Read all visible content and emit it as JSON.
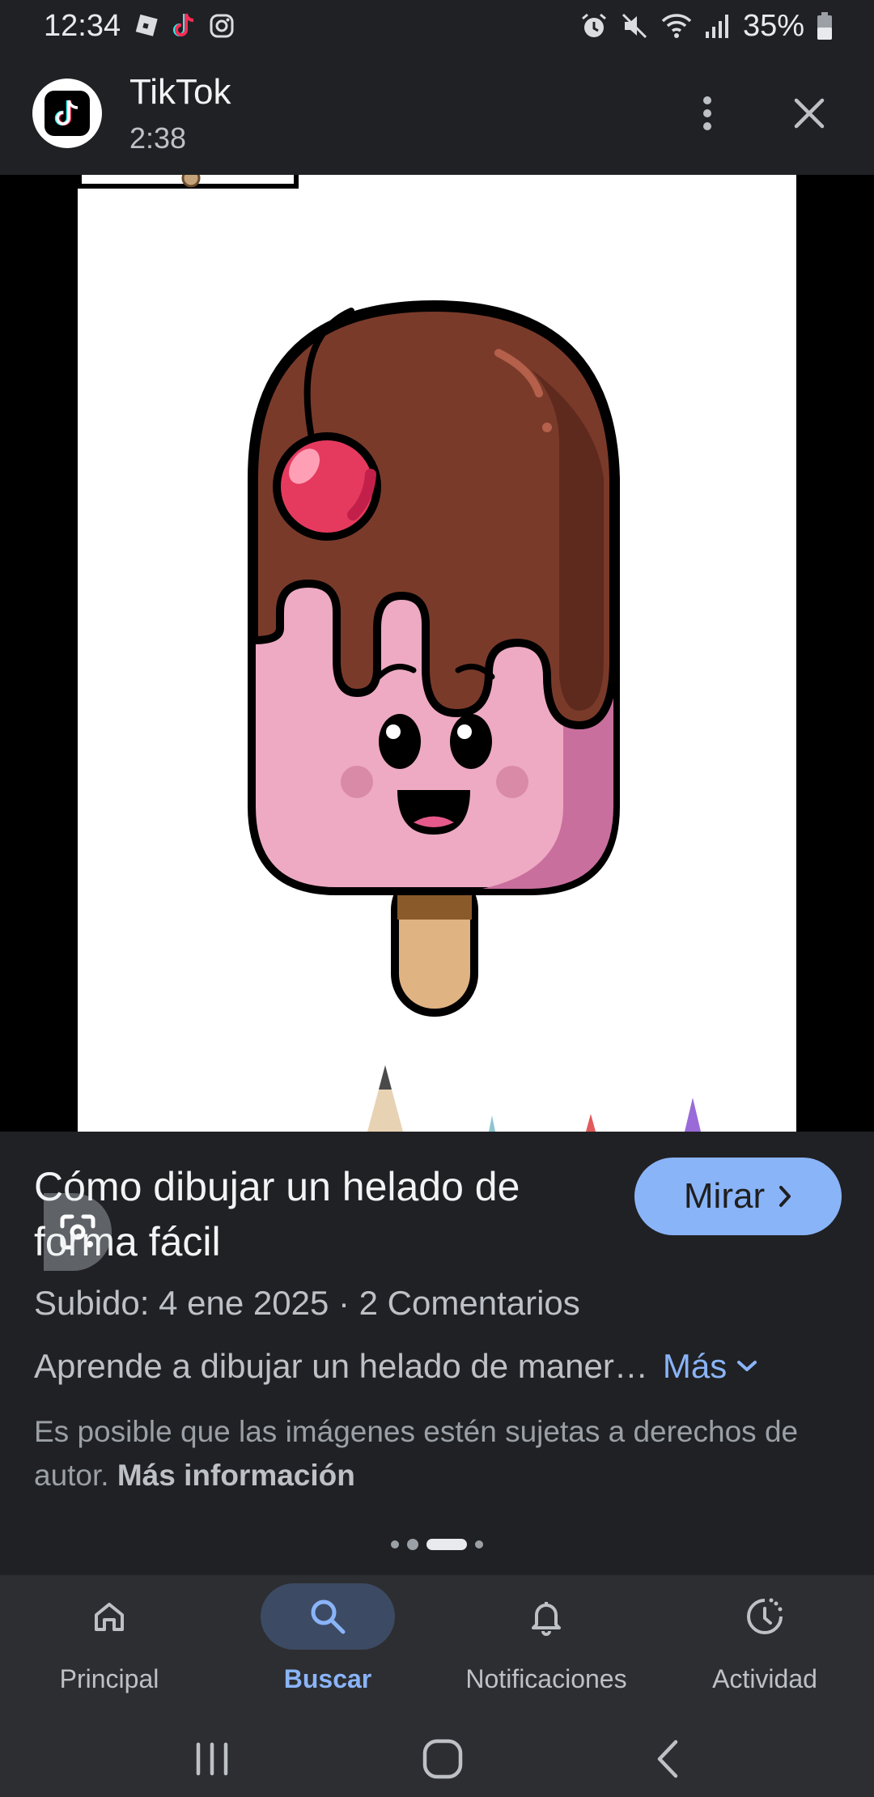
{
  "status_bar": {
    "time": "12:34",
    "battery": "35%",
    "left_icons": [
      "roblox-icon",
      "tiktok-icon",
      "instagram-icon"
    ],
    "right_icons": [
      "alarm-icon",
      "mute-icon",
      "wifi-icon",
      "signal-icon",
      "battery-icon"
    ]
  },
  "header": {
    "app_name": "TikTok",
    "duration": "2:38",
    "menu_icon": "more-vertical-icon",
    "close_icon": "close-icon"
  },
  "media": {
    "lens_icon": "lens-icon"
  },
  "info": {
    "title": "Cómo dibujar un helado de forma fácil",
    "watch_label": "Mirar",
    "meta": "Subido: 4 ene 2025 · 2 Comentarios",
    "description": "Aprende a dibujar un helado de maner…",
    "more_label": "Más",
    "copyright_text": "Es posible que las imágenes estén sujetas a derechos de autor.",
    "copyright_link": "Más información"
  },
  "bottom_nav": {
    "items": [
      {
        "label": "Principal",
        "icon": "home-icon"
      },
      {
        "label": "Buscar",
        "icon": "search-icon",
        "active": true
      },
      {
        "label": "Notificaciones",
        "icon": "bell-icon"
      },
      {
        "label": "Actividad",
        "icon": "activity-icon"
      }
    ]
  },
  "colors": {
    "background": "#202124",
    "accent": "#8ab4f8",
    "nav_background": "#2d2e31"
  }
}
